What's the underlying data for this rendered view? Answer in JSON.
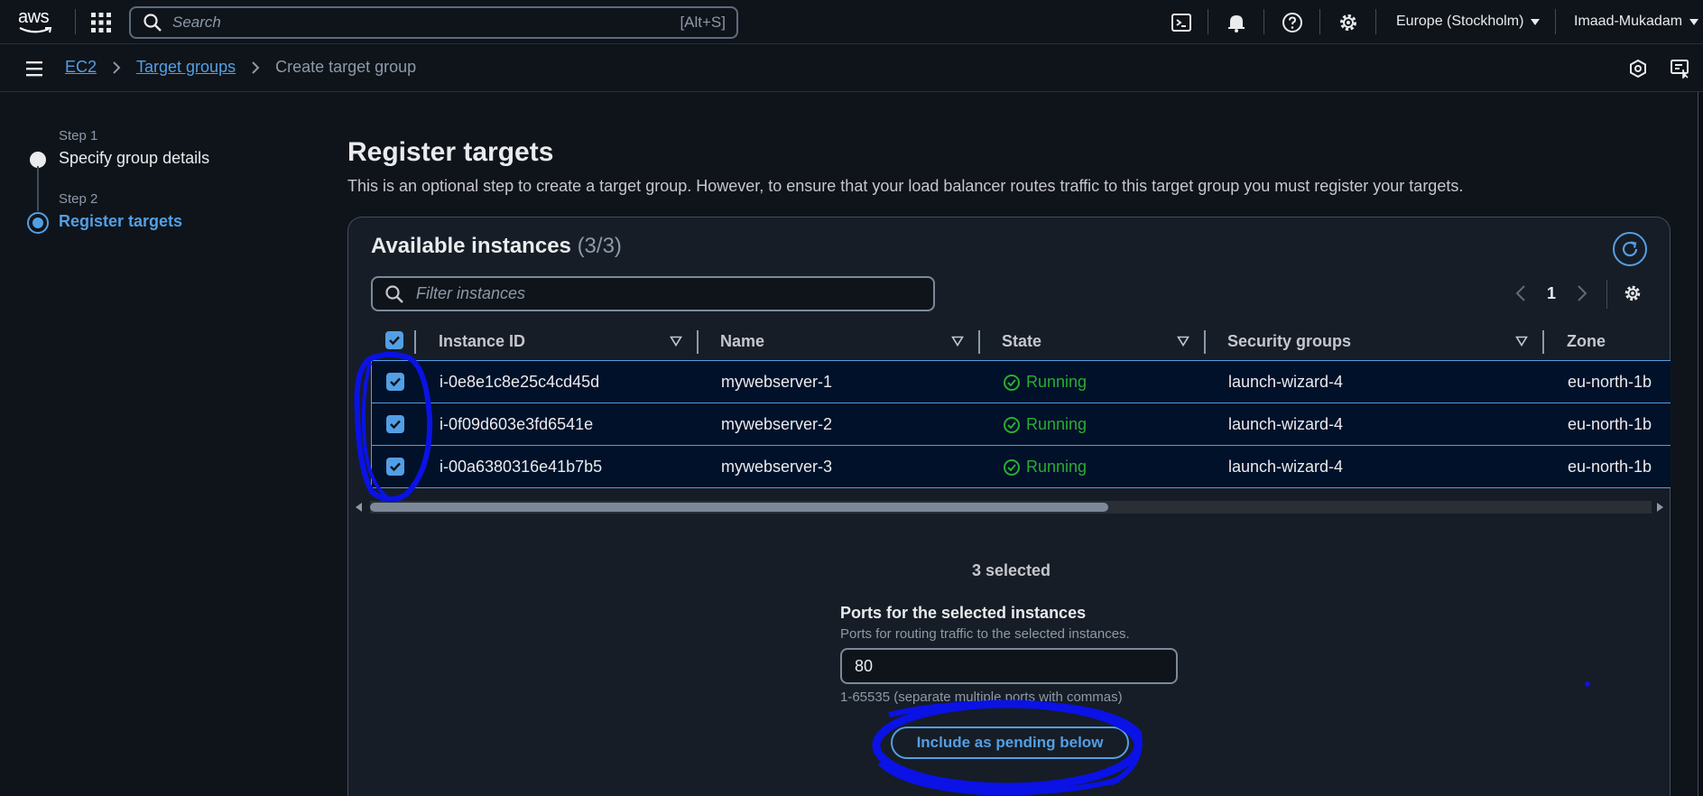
{
  "topnav": {
    "logo_text": "aws",
    "search_placeholder": "Search",
    "search_shortcut": "[Alt+S]",
    "region": "Europe (Stockholm)",
    "user": "Imaad-Mukadam",
    "icons": [
      "apps-grid-icon",
      "cloudshell-icon",
      "bell-icon",
      "help-icon",
      "gear-icon"
    ]
  },
  "breadcrumb": {
    "items": [
      "EC2",
      "Target groups"
    ],
    "current": "Create target group"
  },
  "steps": [
    {
      "label": "Step 1",
      "title": "Specify group details",
      "active": false
    },
    {
      "label": "Step 2",
      "title": "Register targets",
      "active": true
    }
  ],
  "main": {
    "title": "Register targets",
    "description": "This is an optional step to create a target group. However, to ensure that your load balancer routes traffic to this target group you must register your targets."
  },
  "instances_panel": {
    "title": "Available instances",
    "count": "(3/3)",
    "filter_placeholder": "Filter instances",
    "page": "1",
    "columns": [
      "Instance ID",
      "Name",
      "State",
      "Security groups",
      "Zone"
    ],
    "rows": [
      {
        "id": "i-0e8e1c8e25c4cd45d",
        "name": "mywebserver-1",
        "state": "Running",
        "security_group": "launch-wizard-4",
        "zone": "eu-north-1b",
        "checked": true
      },
      {
        "id": "i-0f09d603e3fd6541e",
        "name": "mywebserver-2",
        "state": "Running",
        "security_group": "launch-wizard-4",
        "zone": "eu-north-1b",
        "checked": true
      },
      {
        "id": "i-00a6380316e41b7b5",
        "name": "mywebserver-3",
        "state": "Running",
        "security_group": "launch-wizard-4",
        "zone": "eu-north-1b",
        "checked": true
      }
    ],
    "selected_text": "3 selected",
    "ports_label": "Ports for the selected instances",
    "ports_description": "Ports for routing traffic to the selected instances.",
    "ports_value": "80",
    "ports_hint": "1-65535 (separate multiple ports with commas)",
    "include_button": "Include as pending below"
  },
  "colors": {
    "background": "#0f141a",
    "panel": "#161d26",
    "accent": "#539fe5",
    "running": "#29ad32",
    "row_selected": "#001129",
    "annotation": "#0a12e6"
  }
}
